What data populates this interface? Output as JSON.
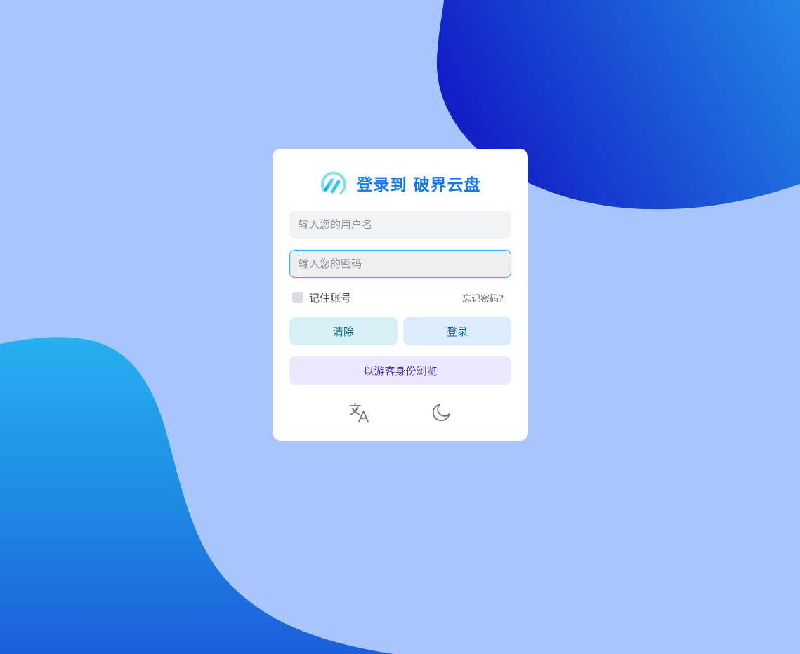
{
  "login": {
    "title": "登录到 破界云盘",
    "username_placeholder": "输入您的用户名",
    "password_placeholder": "输入您的密码",
    "remember_label": "记住账号",
    "forgot_label": "忘记密码?",
    "clear_label": "清除",
    "login_label": "登录",
    "guest_label": "以游客身份浏览"
  },
  "icons": {
    "logo": "brand-logo-icon",
    "translate": "translate-icon",
    "theme": "moon-icon"
  },
  "colors": {
    "background": "#a9c5fd",
    "brand": "#1677e6",
    "clear_bg": "#d6f1f6",
    "login_bg": "#dcecfd",
    "guest_bg": "#ece8fd",
    "focus_border": "#4ea3f4"
  }
}
